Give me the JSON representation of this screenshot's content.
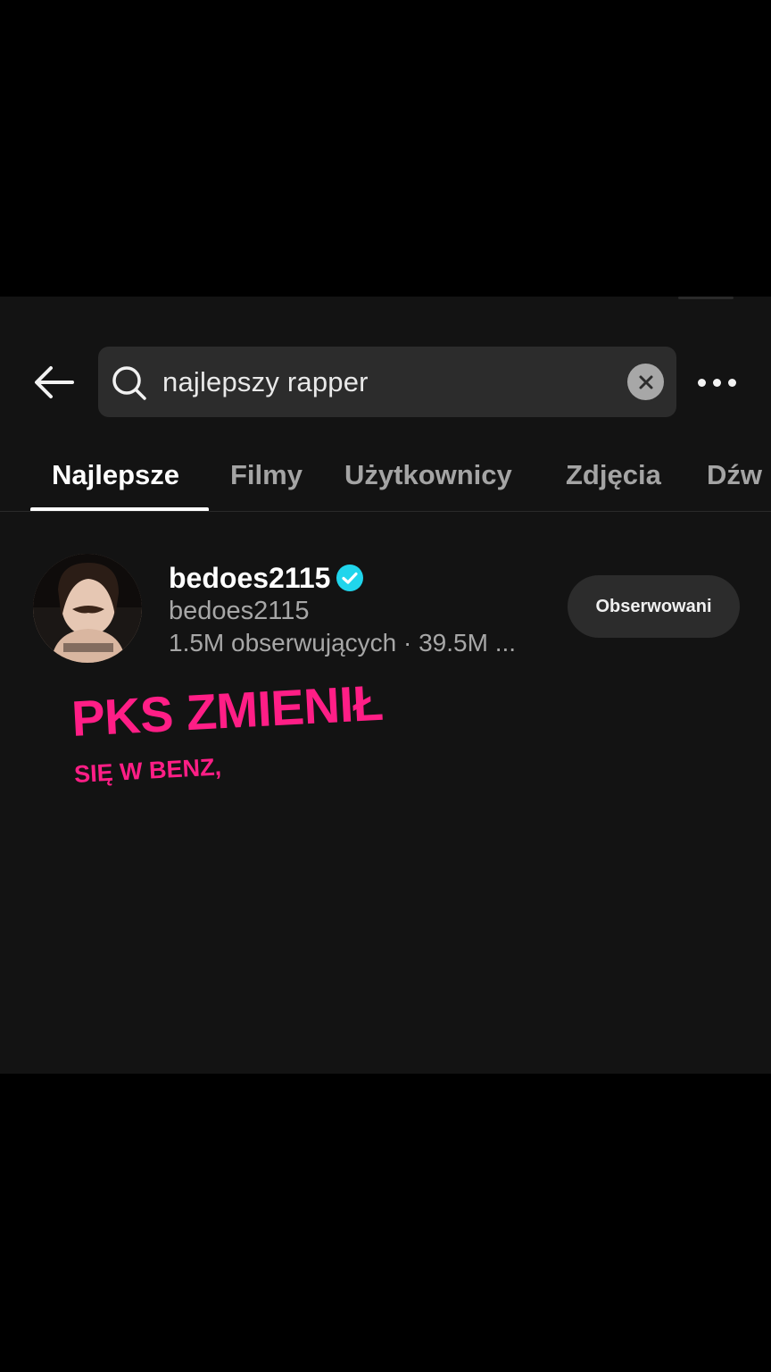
{
  "search": {
    "query": "najlepszy rapper"
  },
  "tabs": [
    {
      "label": "Najlepsze",
      "active": true
    },
    {
      "label": "Filmy"
    },
    {
      "label": "Użytkownicy"
    },
    {
      "label": "Zdjęcia"
    },
    {
      "label": "Dźw"
    }
  ],
  "result": {
    "username": "bedoes2115",
    "handle": "bedoes2115",
    "meta": "1.5M obserwujących · 39.5M ...",
    "verified": true,
    "follow_label": "Obserwowani"
  },
  "caption": {
    "line1": "PKS ZMIENIŁ",
    "line2": "SIĘ W BENZ,"
  },
  "colors": {
    "background": "#131313",
    "search_bg": "#2c2c2c",
    "accent_pink": "#ff1e86",
    "verified": "#20d5ec"
  },
  "icons": [
    "back-arrow-icon",
    "search-icon",
    "clear-icon",
    "more-icon",
    "verified-icon"
  ]
}
